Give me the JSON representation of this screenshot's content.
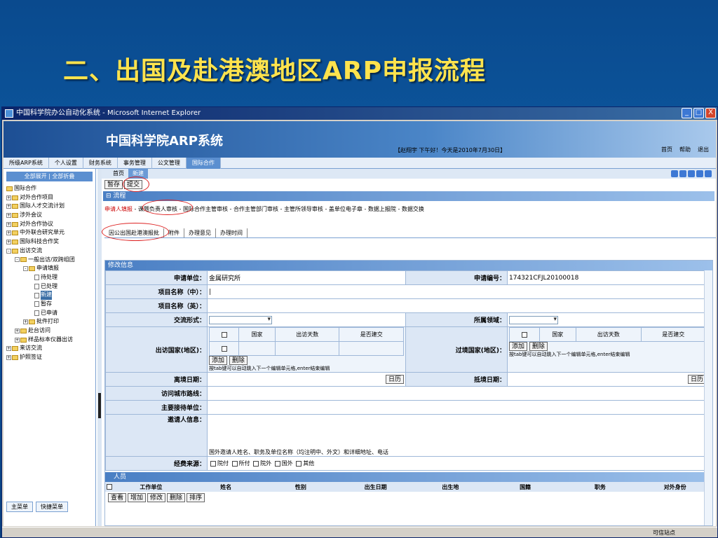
{
  "slide": {
    "title": "二、出国及赴港澳地区ARP申报流程"
  },
  "window": {
    "title": "中国科学院办公自动化系统 - Microsoft Internet Explorer",
    "min": "_",
    "max": "□",
    "close": "X"
  },
  "header": {
    "logo": "中国科学院ARP系统",
    "greeting": "【赵翔宇 下午好！今天是2010年7月30日】",
    "links": [
      "首页",
      "帮助",
      "退出"
    ]
  },
  "mainnav": [
    "所级ARP系统",
    "个人设置",
    "财务系统",
    "事务管理",
    "公文管理",
    "国际合作"
  ],
  "sidebar": {
    "expand": "全部展开 | 全部折叠",
    "tree": [
      "国际合作",
      "对外合作项目",
      "国际人才交流计划",
      "涉外会议",
      "对外合作协议",
      "中外联合研究单元",
      "国际科技合作奖",
      "出访交流",
      "一般出访/双跨组团",
      "申请填报",
      "待处理",
      "已处理",
      "新建",
      "暂存",
      "已申请",
      "批件打印",
      "赴台访问",
      "样品标本仪器出访",
      "来访交流",
      "护照签证"
    ],
    "bottom_tabs": [
      "主菜单",
      "快捷菜单"
    ]
  },
  "content": {
    "subtabs": [
      "首页",
      "新建"
    ],
    "buttons": {
      "save": "暂存",
      "submit": "提交"
    },
    "flow_title": "流程",
    "flow": [
      "申请人填报",
      "课题负责人审核",
      "国际合作主管审核",
      "合作主管部门审核",
      "主管所领导审核",
      "盖单位电子章",
      "数据上报院",
      "数据交换"
    ],
    "tabs": [
      "因公出国赴港澳报批",
      "附件",
      "办理意见",
      "办理时间"
    ],
    "form_title": "修改信息",
    "labels": {
      "unit": "申请单位：",
      "apply_no": "申请编号：",
      "proj_cn": "项目名称（中）：",
      "proj_en": "项目名称（英）：",
      "exchange": "交流形式：",
      "field": "所属领域：",
      "visit_country": "出访国家(地区)：",
      "transit_country": "过境国家(地区)：",
      "depart": "离境日期：",
      "arrive": "抵境日期：",
      "route": "访问城市路线：",
      "host": "主要接待单位：",
      "inviter": "邀请人信息：",
      "fund": "经费来源："
    },
    "values": {
      "unit": "金属研究所",
      "apply_no": "174321CFJL20100018"
    },
    "country_cols": [
      "国家",
      "出访天数",
      "是否建交"
    ],
    "transit_cols": [
      "国家",
      "出访天数",
      "是否建交"
    ],
    "add": "添加",
    "del": "删除",
    "hint": "按tab键可以自动跳入下一个编辑单元格,enter结束编辑",
    "calendar": "日历",
    "inviter_hint": "国外邀请人姓名、职务及单位名称（均注明中、外文）和详细地址、电话",
    "fund_opts": [
      "院付",
      "所付",
      "院外",
      "国外",
      "其他"
    ],
    "persons_title": "人员",
    "person_cols": [
      "工作单位",
      "姓名",
      "性别",
      "出生日期",
      "出生地",
      "国籍",
      "职务",
      "对外身份"
    ],
    "person_btns": [
      "查看",
      "增加",
      "修改",
      "删除",
      "排序"
    ]
  },
  "status": {
    "zone": "可信站点"
  }
}
